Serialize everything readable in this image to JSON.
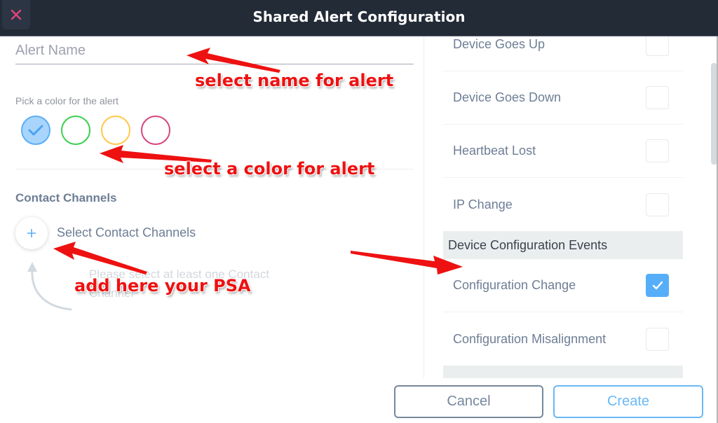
{
  "header": {
    "title": "Shared Alert Configuration",
    "close_icon": "close-icon"
  },
  "form": {
    "alert_name": {
      "value": "",
      "placeholder": "Alert Name"
    },
    "color_label": "Pick a color for the alert",
    "colors": [
      {
        "name": "blue",
        "hex": "#5aaef9",
        "selected": true
      },
      {
        "name": "green",
        "hex": "#3ccf4e",
        "selected": false
      },
      {
        "name": "yellow",
        "hex": "#ffc84a",
        "selected": false
      },
      {
        "name": "pink",
        "hex": "#d7457f",
        "selected": false
      }
    ],
    "contact_channels": {
      "title": "Contact Channels",
      "add_label": "Select Contact Channels",
      "hint": "Please select at least one Contact Channel"
    }
  },
  "events": {
    "rows_top": [
      {
        "label": "Device Goes Up",
        "checked": false
      },
      {
        "label": "Device Goes Down",
        "checked": false
      },
      {
        "label": "Heartbeat Lost",
        "checked": false
      },
      {
        "label": "IP Change",
        "checked": false
      }
    ],
    "section": "Device Configuration Events",
    "rows_config": [
      {
        "label": "Configuration Change",
        "checked": true
      },
      {
        "label": "Configuration Misalignment",
        "checked": false
      }
    ]
  },
  "footer": {
    "cancel_label": "Cancel",
    "create_label": "Create"
  },
  "annotations": {
    "name": "select name for alert",
    "color": "select a color for alert",
    "psa": "add here your PSA"
  },
  "colors": {
    "header_bg": "#232b37",
    "accent": "#56aef9",
    "annotation": "#ee1111",
    "close_icon": "#e0457f"
  }
}
